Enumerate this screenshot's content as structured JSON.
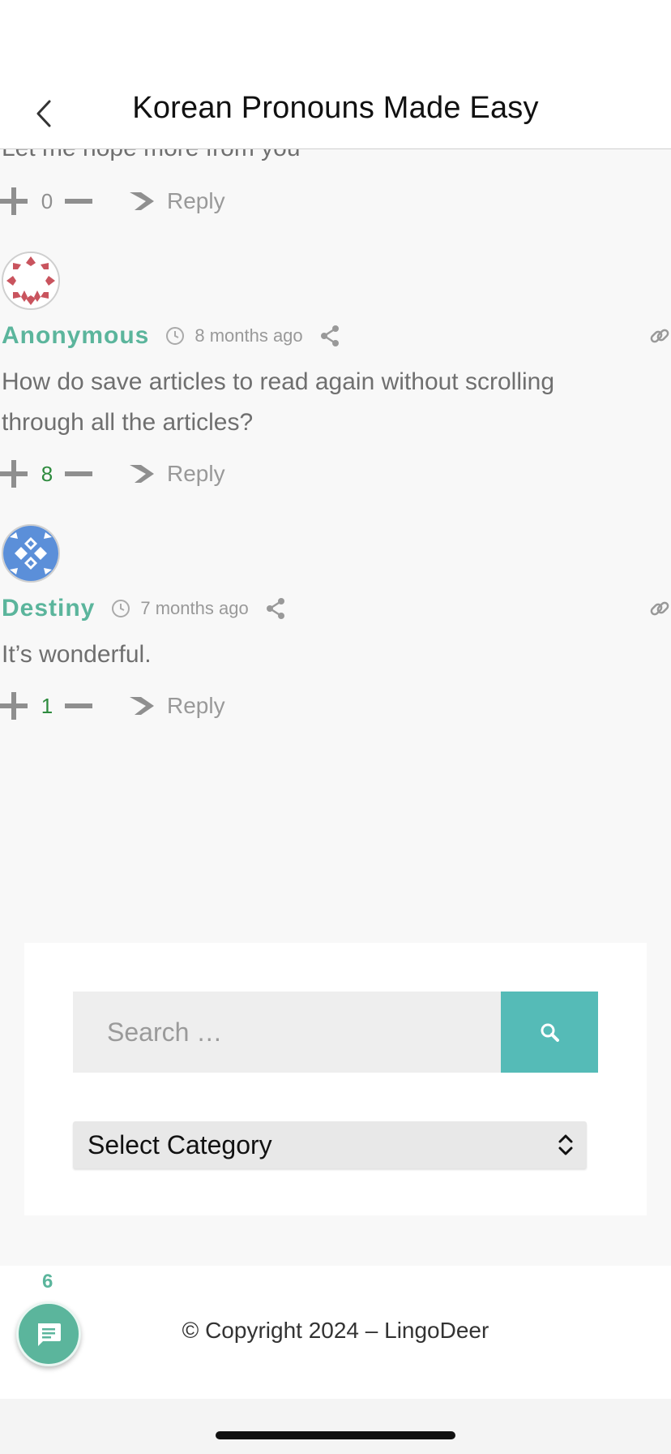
{
  "header": {
    "title": "Korean Pronouns Made Easy"
  },
  "partial_comment": {
    "text": "Let me hope more from you",
    "votes": "0",
    "reply_label": "Reply"
  },
  "comments": [
    {
      "author": "Anonymous",
      "time": "8 months ago",
      "text": "How do save articles to read again without scrolling through all the articles?",
      "votes": "8",
      "reply_label": "Reply",
      "avatar_color": "#c9545e"
    },
    {
      "author": "Destiny",
      "time": "7 months ago",
      "text": "It’s wonderful.",
      "votes": "1",
      "reply_label": "Reply",
      "avatar_color": "#5b8fd9"
    }
  ],
  "search": {
    "placeholder": "Search …"
  },
  "category_select": {
    "selected": "Select Category"
  },
  "chat": {
    "count": "6"
  },
  "footer": {
    "copyright": "© Copyright 2024 – LingoDeer"
  },
  "colors": {
    "accent": "#5bb59c",
    "search_button": "#55bbb7",
    "positive_vote": "#2e8b3e"
  }
}
